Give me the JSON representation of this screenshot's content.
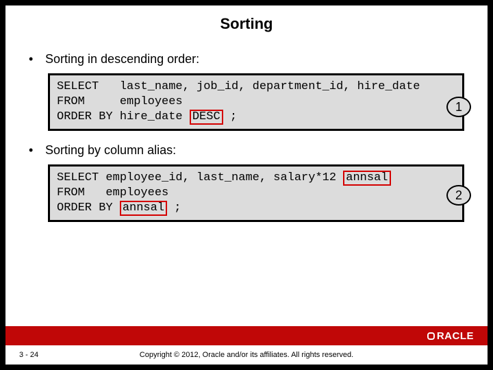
{
  "title": "Sorting",
  "bullets": {
    "b1": "Sorting in descending order:",
    "b2": "Sorting by column alias:"
  },
  "code1": {
    "l1a": "SELECT   last_name, job_id, department_id, hire_date",
    "l2a": "FROM     employees",
    "l3a": "ORDER BY hire_date ",
    "l3hl": "DESC",
    "l3b": " ;"
  },
  "code2": {
    "l1a": "SELECT employee_id, last_name, salary*12 ",
    "l1hl": "annsal",
    "l2a": "FROM   employees",
    "l3a": "ORDER BY ",
    "l3hl": "annsal",
    "l3b": " ;"
  },
  "badges": {
    "one": "1",
    "two": "2"
  },
  "footer": {
    "page": "3 - 24",
    "copyright": "Copyright © 2012, Oracle and/or its affiliates. All rights reserved.",
    "logo_text": "RACLE"
  }
}
